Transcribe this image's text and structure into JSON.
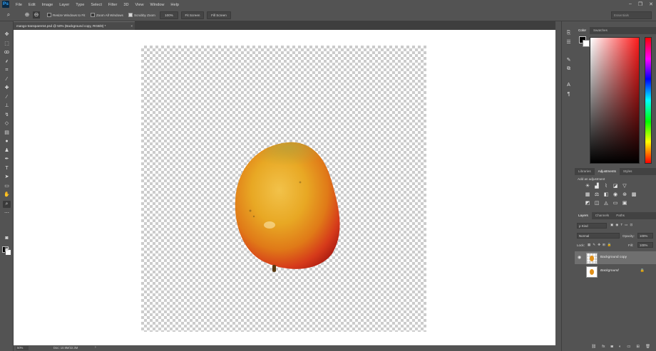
{
  "app": {
    "logo": "Ps"
  },
  "menubar": {
    "items": [
      "File",
      "Edit",
      "Image",
      "Layer",
      "Type",
      "Select",
      "Filter",
      "3D",
      "View",
      "Window",
      "Help"
    ]
  },
  "window_controls": {
    "minimize": "–",
    "restore": "❐",
    "close": "✕"
  },
  "options_bar": {
    "tool_icon": "zoom-icon",
    "resize_windows_label": "Resize Windows to Fit",
    "zoom_all_windows_label": "Zoom All Windows",
    "scrubby_zoom_label": "Scrubby Zoom",
    "btn_100": "100%",
    "btn_fit_screen": "Fit Screen",
    "btn_fill_screen": "Fill Screen",
    "workspace_placeholder": "Essentials"
  },
  "document": {
    "tab_title": "mango-transparent4.psd @ 50% (Background copy, RGB/8) *",
    "close": "×"
  },
  "status": {
    "zoom": "50%",
    "doc_info": "Doc: 10.9M/22.3M",
    "arrow": "›"
  },
  "panels": {
    "color_tabs": [
      "Color",
      "Swatches"
    ],
    "adjust_tabs": [
      "Libraries",
      "Adjustments",
      "Styles"
    ],
    "adjustments_title": "Add an adjustment",
    "layers_tabs": [
      "Layers",
      "Channels",
      "Paths"
    ],
    "kind_filter": "ρ Kind",
    "blend_mode": "Normal",
    "opacity_label": "Opacity:",
    "opacity_value": "100%",
    "lock_label": "Lock:",
    "fill_label": "Fill:",
    "fill_value": "100%",
    "layers": [
      {
        "name": "Background copy",
        "selected": true,
        "visible": true
      },
      {
        "name": "Background",
        "selected": false,
        "visible": false,
        "locked": true
      }
    ]
  },
  "colors": {
    "accent": "#31a8ff",
    "ui_bg": "#535353",
    "selected_layer": "#6f6f6f"
  }
}
